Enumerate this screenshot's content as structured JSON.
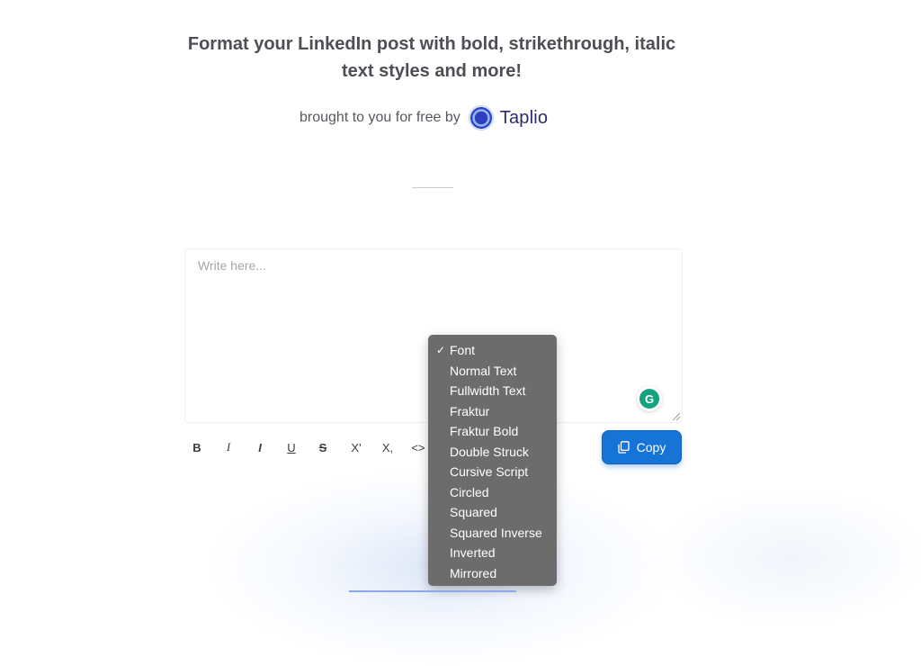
{
  "header": {
    "headline": "Format your LinkedIn post with bold, strikethrough, italic text styles and more!",
    "byline": "brought to you for free by",
    "brand": "Taplio"
  },
  "editor": {
    "placeholder": "Write here...",
    "value": ""
  },
  "toolbar": {
    "bold": "B",
    "italic": "I",
    "bold_italic": "I",
    "underline": "U",
    "strikethrough": "S",
    "superscript": "X'",
    "subscript": "X,",
    "code": "<>"
  },
  "copy_button": {
    "label": "Copy"
  },
  "grammarly": {
    "letter": "G"
  },
  "font_menu": {
    "checkmark": "✓",
    "selected": "Font",
    "items": [
      "Font",
      "Normal Text",
      "Fullwidth Text",
      "Fraktur",
      "Fraktur Bold",
      "Double Struck",
      "Cursive Script",
      "Circled",
      "Squared",
      "Squared Inverse",
      "Inverted",
      "Mirrored"
    ]
  },
  "colors": {
    "accent": "#1574d6",
    "menu_bg": "#6c6c6c",
    "brand_text": "#2e2a6b",
    "grammarly": "#15a27e"
  }
}
